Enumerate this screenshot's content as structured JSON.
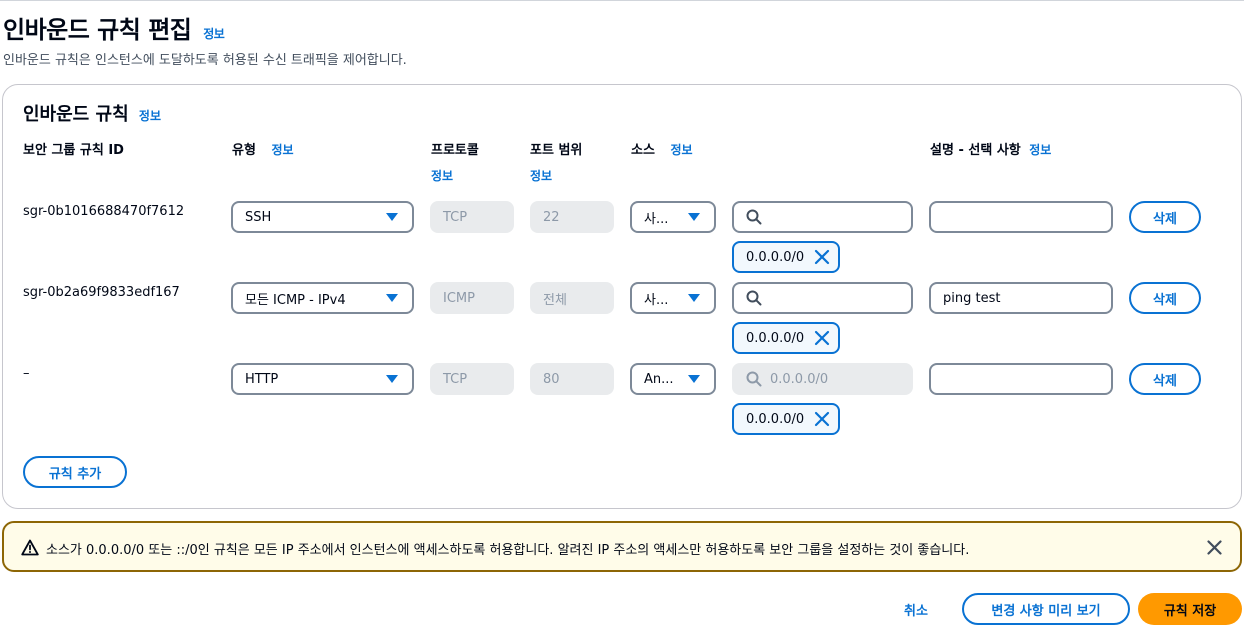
{
  "page": {
    "title": "인바운드 규칙 편집",
    "title_info": "정보",
    "description": "인바운드 규칙은 인스턴스에 도달하도록 허용된 수신 트래픽을 제어합니다."
  },
  "panel": {
    "title": "인바운드 규칙",
    "title_info": "정보",
    "columns": {
      "rule_id": "보안 그룹 규칙 ID",
      "type": "유형",
      "type_info": "정보",
      "protocol": "프로토콜",
      "protocol_info": "정보",
      "port_range": "포트 범위",
      "port_info": "정보",
      "source": "소스",
      "source_info": "정보",
      "description": "설명 - 선택 사항",
      "description_info": "정보"
    },
    "rows": [
      {
        "id": "sgr-0b1016688470f7612",
        "type": "SSH",
        "protocol": "TCP",
        "port": "22",
        "source_type": "사...",
        "source_search_placeholder": "",
        "source_token": "0.0.0.0/0",
        "description": "",
        "delete_label": "삭제"
      },
      {
        "id": "sgr-0b2a69f9833edf167",
        "type": "모든 ICMP - IPv4",
        "protocol": "ICMP",
        "port": "전체",
        "source_type": "사...",
        "source_search_placeholder": "",
        "source_token": "0.0.0.0/0",
        "description": "ping test",
        "delete_label": "삭제"
      },
      {
        "id": "–",
        "type": "HTTP",
        "protocol": "TCP",
        "port": "80",
        "source_type": "An...",
        "source_search_placeholder": "0.0.0.0/0",
        "source_token": "0.0.0.0/0",
        "description": "",
        "delete_label": "삭제"
      }
    ],
    "add_rule_label": "규칙 추가"
  },
  "alert": {
    "message": "소스가 0.0.0.0/0 또는 ::/0인 규칙은 모든 IP 주소에서 인스턴스에 액세스하도록 허용합니다. 알려진 IP 주소의 액세스만 허용하도록 보안 그룹을 설정하는 것이 좋습니다."
  },
  "footer": {
    "cancel_label": "취소",
    "preview_label": "변경 사항 미리 보기",
    "save_label": "규칙 저장"
  },
  "colors": {
    "accent": "#0972d3",
    "primary_button": "#ff9900",
    "warning_border": "#8d6605",
    "warning_bg": "#fffce9"
  }
}
